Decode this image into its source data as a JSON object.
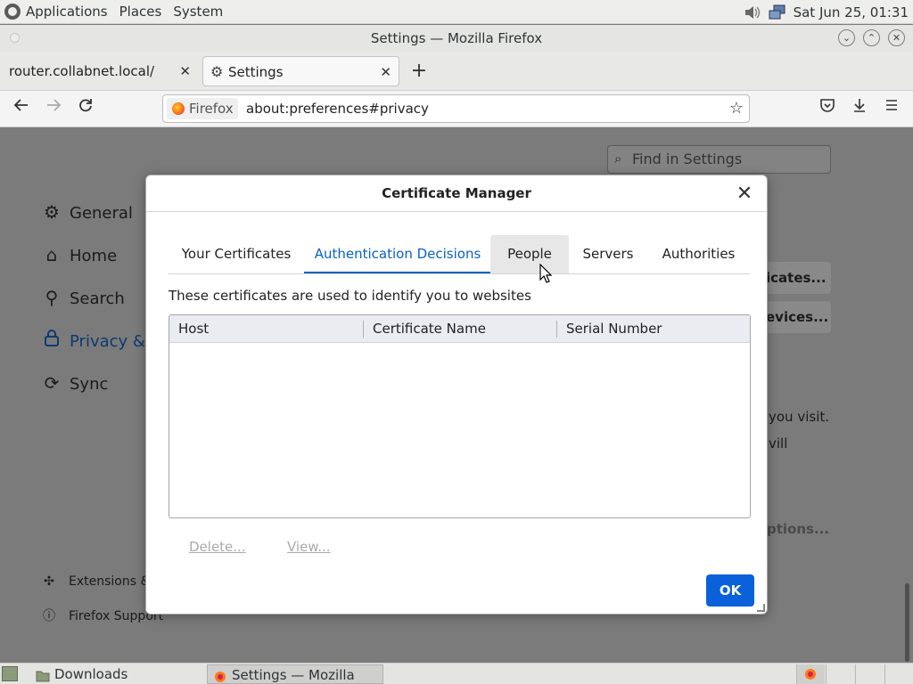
{
  "top_panel": {
    "menus": [
      "Applications",
      "Places",
      "System"
    ],
    "clock": "Sat Jun 25, 01:31"
  },
  "window": {
    "title": "Settings — Mozilla Firefox"
  },
  "tabs": [
    {
      "label": "router.collabnet.local/",
      "active": false
    },
    {
      "label": "Settings",
      "active": true
    }
  ],
  "navbar": {
    "identity": "Firefox",
    "url": "about:preferences#privacy"
  },
  "settings_page": {
    "search_placeholder": "Find in Settings",
    "nav": [
      {
        "label": "General",
        "icon": "gear-icon"
      },
      {
        "label": "Home",
        "icon": "home-icon"
      },
      {
        "label": "Search",
        "icon": "search-icon"
      },
      {
        "label": "Privacy & S",
        "icon": "lock-icon",
        "selected": true
      },
      {
        "label": "Sync",
        "icon": "sync-icon"
      }
    ],
    "bottom_links": [
      "Extensions &",
      "Firefox Support"
    ],
    "background_buttons": [
      "icates...",
      "evices...",
      "ptions..."
    ],
    "background_text": [
      "you visit.",
      "vill"
    ]
  },
  "dialog": {
    "title": "Certificate Manager",
    "tabs": [
      {
        "label": "Your Certificates"
      },
      {
        "label": "Authentication Decisions",
        "active": true
      },
      {
        "label": "People",
        "hover": true
      },
      {
        "label": "Servers"
      },
      {
        "label": "Authorities"
      }
    ],
    "description": "These certificates are used to identify you to websites",
    "columns": [
      "Host",
      "Certificate Name",
      "Serial Number"
    ],
    "rows": [],
    "buttons": {
      "delete": "Delete...",
      "view": "View...",
      "ok": "OK"
    }
  },
  "taskbar": {
    "tasks": [
      {
        "label": "Downloads",
        "icon": "folder-icon"
      },
      {
        "label": "Settings — Mozilla Fire...",
        "icon": "firefox-icon",
        "active": true
      }
    ]
  },
  "colors": {
    "accent": "#0a61c7",
    "ok_button": "#0a61d9",
    "page_dim": "#7b7b7b"
  }
}
